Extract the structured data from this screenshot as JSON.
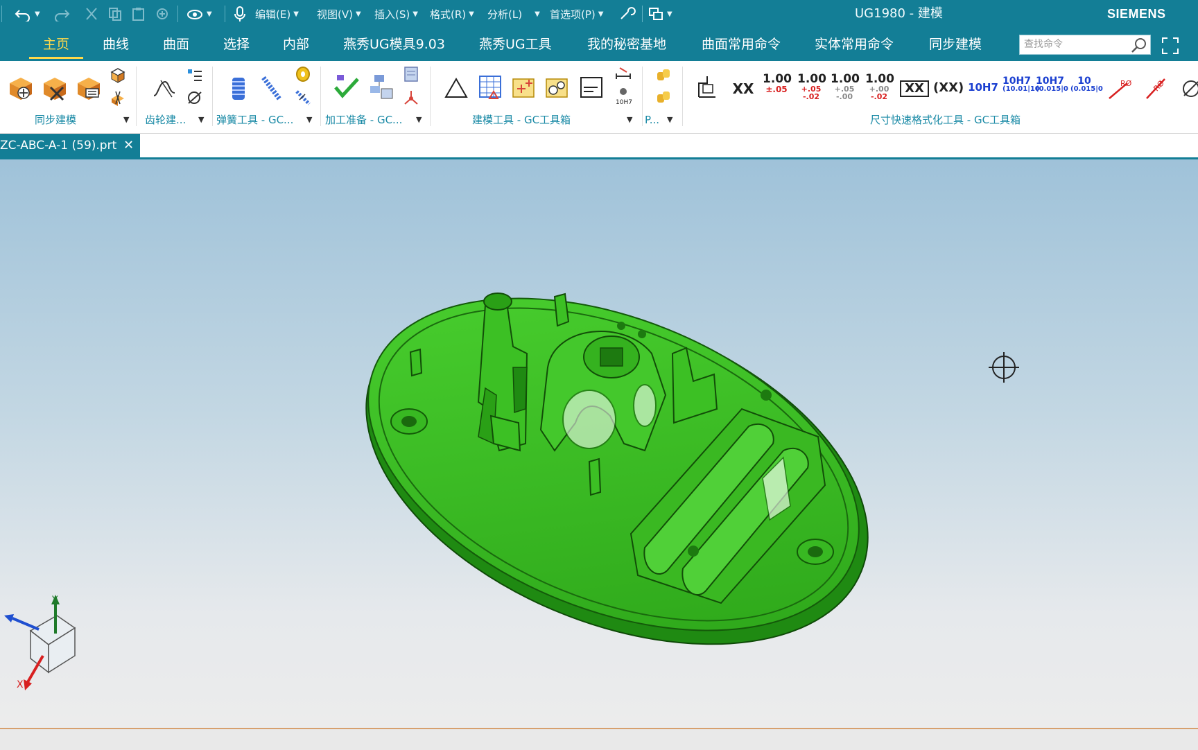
{
  "window": {
    "title": "UG1980 - 建模",
    "brand": "SIEMENS"
  },
  "quick_access": {
    "edit": "编辑(E)",
    "view": "视图(V)",
    "insert": "插入(S)",
    "format": "格式(R)",
    "analysis": "分析(L)",
    "preferences": "首选项(P)"
  },
  "tabs": [
    {
      "label": "主页",
      "active": true
    },
    {
      "label": "曲线"
    },
    {
      "label": "曲面"
    },
    {
      "label": "选择"
    },
    {
      "label": "内部"
    },
    {
      "label": "燕秀UG模具9.03"
    },
    {
      "label": "燕秀UG工具"
    },
    {
      "label": "我的秘密基地"
    },
    {
      "label": "曲面常用命令"
    },
    {
      "label": "实体常用命令"
    },
    {
      "label": "同步建模"
    }
  ],
  "search": {
    "placeholder": "查找命令"
  },
  "ribbon_groups": {
    "sync_modeling": "同步建模",
    "gear": "齿轮建...",
    "spring": "弹簧工具 - GC...",
    "machining": "加工准备 - GC...",
    "modeling_tools": "建模工具 - GC工具箱",
    "p_group": "P...",
    "dimension_format": "尺寸快速格式化工具 - GC工具箱"
  },
  "dim_buttons": {
    "xx": "XX",
    "d1_main": "1.00",
    "d1_tol": "±.05",
    "d2_main": "1.00",
    "d2_up": "+.05",
    "d2_low": "-.02",
    "d3_main": "1.00",
    "d3_up": "+.05",
    "d3_low": "-.00",
    "d4_main": "1.00",
    "d4_up": "+.00",
    "d4_low": "-.02",
    "boxed": "XX",
    "paren": "(XX)",
    "fit": "10H7",
    "fit2_main": "10H7",
    "fit2_sub": "(10.01|10",
    "fit3_main": "10H7",
    "fit3_sub": "(0.015|0",
    "fit4_main": "10",
    "fit4_sub": "(0.015|0"
  },
  "file_tab": {
    "name": "ZC-ABC-A-1 (59).prt",
    "close": "✕"
  },
  "triad": {
    "x": "X",
    "y": "Y"
  },
  "colors": {
    "chrome": "#137e96",
    "active_tab": "#ffd94a",
    "group_label": "#1a8aa6",
    "part_green": "#35c21f"
  }
}
